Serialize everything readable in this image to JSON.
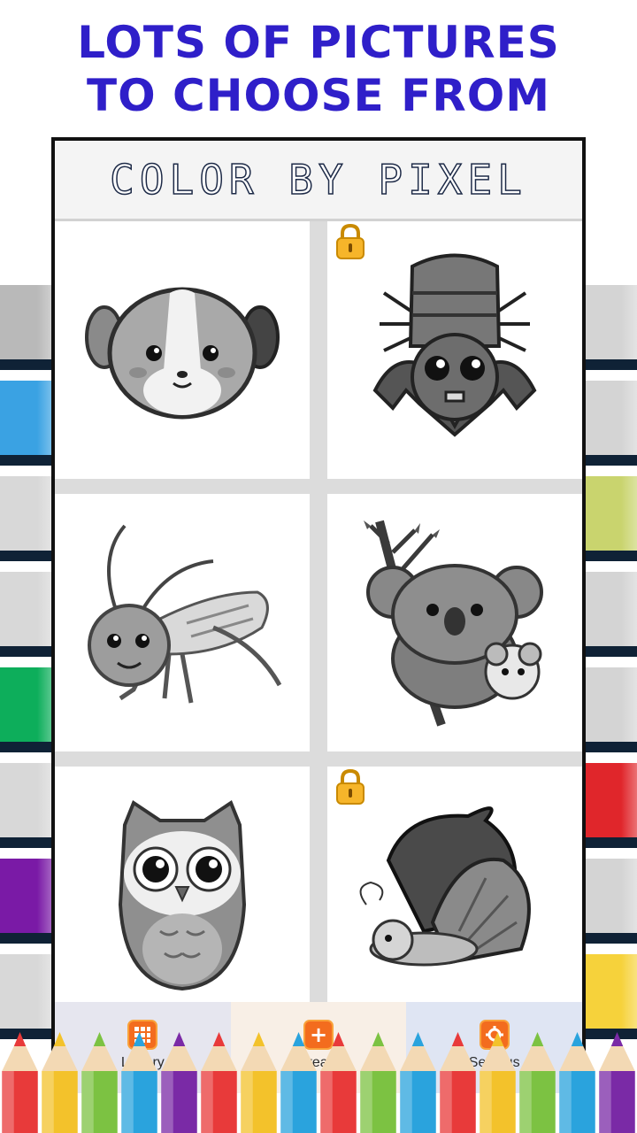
{
  "promo": {
    "line1": "LOTS OF PICTURES",
    "line2": "TO CHOOSE FROM"
  },
  "app": {
    "title": "COLOR BY PIXEL"
  },
  "gallery": {
    "items": [
      {
        "subject": "puppy",
        "locked": false
      },
      {
        "subject": "bat",
        "locked": true
      },
      {
        "subject": "grasshopper",
        "locked": false
      },
      {
        "subject": "koala",
        "locked": false
      },
      {
        "subject": "owl",
        "locked": false
      },
      {
        "subject": "butterfly",
        "locked": true
      }
    ]
  },
  "tabs": [
    {
      "label": "Library",
      "icon": "grid-icon",
      "bg": "#e6e6ef"
    },
    {
      "label": "Create",
      "icon": "plus-icon",
      "bg": "#f8efe6"
    },
    {
      "label": "Settings",
      "icon": "gear-icon",
      "bg": "#dfe5f3"
    }
  ],
  "colors": {
    "headline": "#2f1fc9",
    "left_strip": [
      "#b9b9b9",
      "#3aa2e3",
      "#d8d8d8",
      "#d8d8d8",
      "#0dae5b",
      "#d8d8d8",
      "#7a1aa6",
      "#d8d8d8"
    ],
    "right_strip": [
      "#d4d4d4",
      "#d4d4d4",
      "#c9d46e",
      "#d4d4d4",
      "#d4d4d4",
      "#e0262b",
      "#d4d4d4",
      "#f6d23b"
    ],
    "pencils": [
      "#e83a3a",
      "#f3c22b",
      "#7cc242",
      "#2aa3dd",
      "#7a2aa6",
      "#e83a3a",
      "#f3c22b",
      "#2aa3dd",
      "#e83a3a",
      "#7cc242",
      "#2aa3dd",
      "#e83a3a",
      "#f3c22b",
      "#7cc242",
      "#2aa3dd",
      "#7a2aa6"
    ]
  }
}
